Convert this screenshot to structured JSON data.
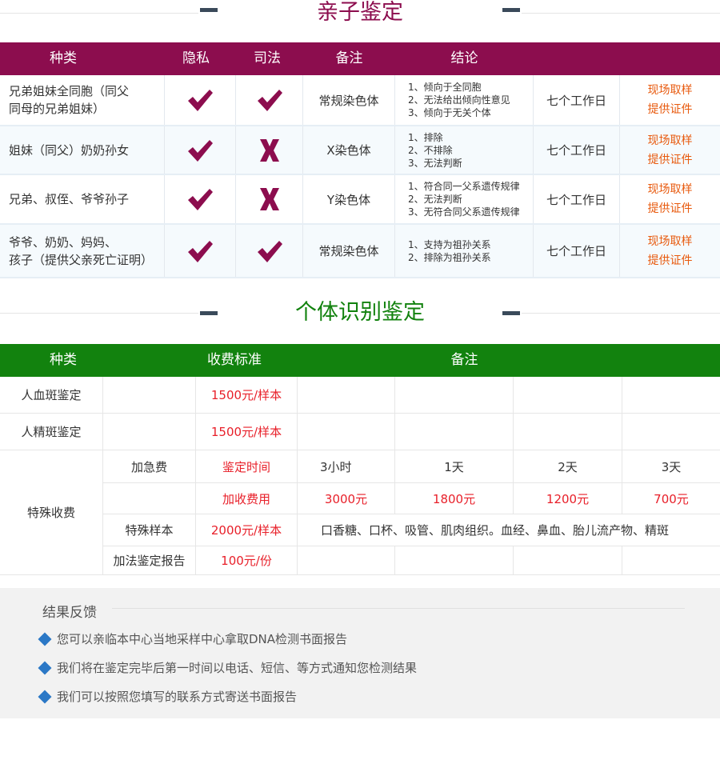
{
  "colors": {
    "paternity_accent": "#8c0d4e",
    "individual_accent": "#12820e",
    "action_orange": "#e85a0e",
    "price_red": "#e8202a"
  },
  "paternity": {
    "title": "亲子鉴定",
    "headers": {
      "kind": "种类",
      "privacy": "隐私",
      "judicial": "司法",
      "note": "备注",
      "conclusion": "结论"
    },
    "rows": [
      {
        "kind": [
          "兄弟姐妹全同胞（同父",
          "同母的兄弟姐妹）"
        ],
        "privacy": "check-icon",
        "judicial": "check-icon",
        "note": "常规染色体",
        "conclusion": [
          "1、倾向于全同胞",
          "2、无法给出倾向性意见",
          "3、倾向于无关个体"
        ],
        "days": "七个工作日",
        "action1": "现场取样",
        "action2": "提供证件"
      },
      {
        "kind": [
          "姐妹（同父）奶奶孙女"
        ],
        "privacy": "check-icon",
        "judicial": "cross-icon",
        "note": "X染色体",
        "conclusion": [
          "1、排除",
          "2、不排除",
          "3、无法判断"
        ],
        "days": "七个工作日",
        "action1": "现场取样",
        "action2": "提供证件"
      },
      {
        "kind": [
          "兄弟、叔侄、爷爷孙子"
        ],
        "privacy": "check-icon",
        "judicial": "cross-icon",
        "note": "Y染色体",
        "conclusion": [
          "1、符合同一父系遗传规律",
          "2、无法判断",
          "3、无符合同父系遗传规律"
        ],
        "days": "七个工作日",
        "action1": "现场取样",
        "action2": "提供证件"
      },
      {
        "kind": [
          "爷爷、奶奶、妈妈、",
          "孩子（提供父亲死亡证明）"
        ],
        "privacy": "check-icon",
        "judicial": "check-icon",
        "note": "常规染色体",
        "conclusion": [
          "1、支持为祖孙关系",
          "2、排除为祖孙关系"
        ],
        "days": "七个工作日",
        "action1": "现场取样",
        "action2": "提供证件"
      }
    ]
  },
  "individual": {
    "title": "个体识别鉴定",
    "headers": {
      "kind": "种类",
      "fee": "收费标准",
      "note": "备注"
    },
    "blood": {
      "label": "人血斑鉴定",
      "price": "1500元/样本"
    },
    "semen": {
      "label": "人精斑鉴定",
      "price": "1500元/样本"
    },
    "special": {
      "label": "特殊收费",
      "urgent_label": "加急费",
      "time_label": "鉴定时间",
      "times": [
        "3小时",
        "1天",
        "2天",
        "3天"
      ],
      "extra_label": "加收费用",
      "extras": [
        "3000元",
        "1800元",
        "1200元",
        "700元"
      ],
      "sample_label": "特殊样本",
      "sample_price": "2000元/样本",
      "sample_note": "口香糖、口杯、吸管、肌肉组织。血经、鼻血、胎儿流产物、精斑",
      "report_label": "加法鉴定报告",
      "report_price": "100元/份"
    }
  },
  "feedback": {
    "title": "结果反馈",
    "items": [
      "您可以亲临本中心当地采样中心拿取DNA检测书面报告",
      "我们将在鉴定完毕后第一时间以电话、短信、等方式通知您检测结果",
      "我们可以按照您填写的联系方式寄送书面报告"
    ]
  }
}
